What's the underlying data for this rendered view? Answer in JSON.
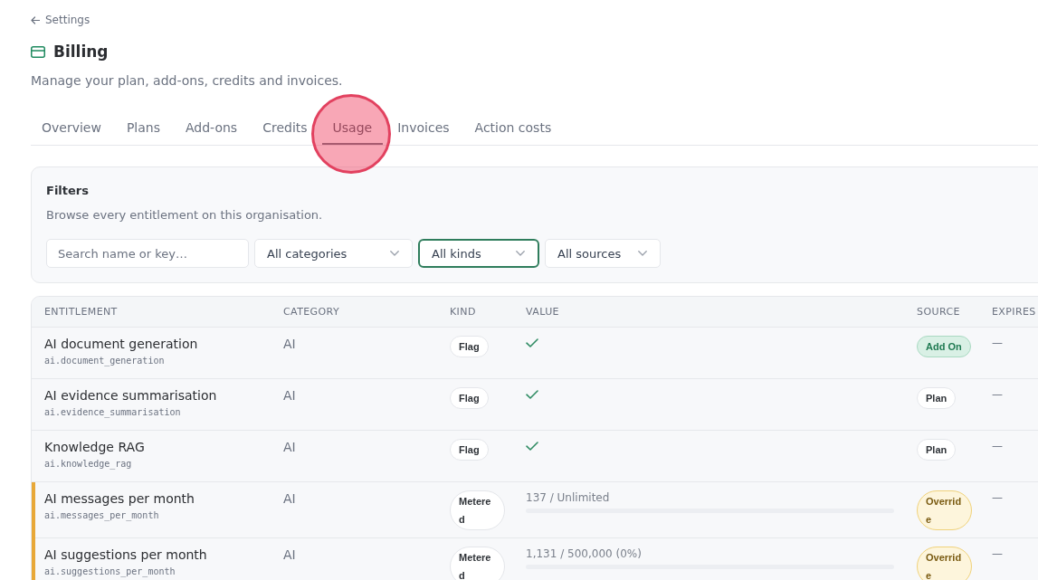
{
  "back_link": {
    "label": "Settings"
  },
  "header": {
    "title": "Billing",
    "subtitle": "Manage your plan, add-ons, credits and invoices."
  },
  "tabs": [
    {
      "label": "Overview",
      "selected": false
    },
    {
      "label": "Plans",
      "selected": false
    },
    {
      "label": "Add-ons",
      "selected": false
    },
    {
      "label": "Credits",
      "selected": false
    },
    {
      "label": "Usage",
      "selected": true
    },
    {
      "label": "Invoices",
      "selected": false
    },
    {
      "label": "Action costs",
      "selected": false
    }
  ],
  "filters": {
    "title": "Filters",
    "description": "Browse every entitlement on this organisation.",
    "controls": [
      {
        "kind": "search",
        "placeholder": "Search name or key…",
        "focused": false
      },
      {
        "kind": "select",
        "value": "All categories",
        "focused": false
      },
      {
        "kind": "select",
        "value": "All kinds",
        "focused": true
      },
      {
        "kind": "select",
        "value": "All sources",
        "focused": false
      }
    ]
  },
  "table": {
    "columns": [
      "ENTITLEMENT",
      "CATEGORY",
      "KIND",
      "VALUE",
      "SOURCE",
      "EXPIRES"
    ],
    "rows": [
      {
        "name": "AI document generation",
        "key": "ai.document_generation",
        "category": "AI",
        "kind": "flag",
        "kind_label": "Flag",
        "value": {
          "enabled": true
        },
        "source": {
          "label": "Add On",
          "kind": "addon"
        },
        "expires": "—",
        "highlighted": false
      },
      {
        "name": "AI evidence summarisation",
        "key": "ai.evidence_summarisation",
        "category": "AI",
        "kind": "flag",
        "kind_label": "Flag",
        "value": {
          "enabled": true
        },
        "source": {
          "label": "Plan",
          "kind": "plan"
        },
        "expires": "—",
        "highlighted": false
      },
      {
        "name": "Knowledge RAG",
        "key": "ai.knowledge_rag",
        "category": "AI",
        "kind": "flag",
        "kind_label": "Flag",
        "value": {
          "enabled": true
        },
        "source": {
          "label": "Plan",
          "kind": "plan"
        },
        "expires": "—",
        "highlighted": false
      },
      {
        "name": "AI messages per month",
        "key": "ai.messages_per_month",
        "category": "AI",
        "kind": "metered",
        "kind_label": "Metered",
        "value": {
          "reading": "137 / Unlimited",
          "level": 0
        },
        "source": {
          "label": "Override",
          "kind": "override"
        },
        "expires": "—",
        "highlighted": true
      },
      {
        "name": "AI suggestions per month",
        "key": "ai.suggestions_per_month",
        "category": "AI",
        "kind": "metered",
        "kind_label": "Metered",
        "value": {
          "reading": "1,131 / 500,000 (0%)",
          "level": 0
        },
        "source": {
          "label": "Override",
          "kind": "override"
        },
        "expires": "—",
        "highlighted": true
      }
    ]
  }
}
